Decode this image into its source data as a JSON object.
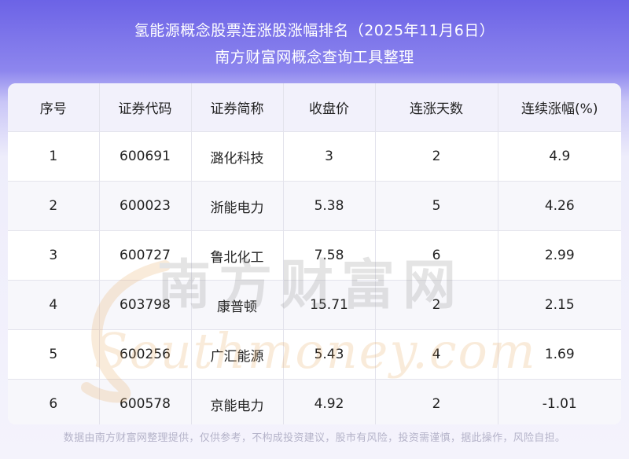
{
  "header": {
    "title": "氢能源概念股票连涨股涨幅排名（2025年11月6日）",
    "subtitle": "南方财富网概念查询工具整理"
  },
  "table": {
    "columns": [
      "序号",
      "证券代码",
      "证券简称",
      "收盘价",
      "连涨天数",
      "连续涨幅(%)"
    ],
    "rows": [
      [
        "1",
        "600691",
        "潞化科技",
        "3",
        "2",
        "4.9"
      ],
      [
        "2",
        "600023",
        "浙能电力",
        "5.38",
        "5",
        "4.26"
      ],
      [
        "3",
        "600727",
        "鲁北化工",
        "7.58",
        "6",
        "2.99"
      ],
      [
        "4",
        "603798",
        "康普顿",
        "15.71",
        "2",
        "2.15"
      ],
      [
        "5",
        "600256",
        "广汇能源",
        "5.43",
        "4",
        "1.69"
      ],
      [
        "6",
        "600578",
        "京能电力",
        "4.92",
        "2",
        "-1.01"
      ]
    ]
  },
  "watermark": {
    "cn": "南方财富网",
    "en": "Southmoney.com"
  },
  "footer": {
    "disclaimer": "数据由南方财富网整理提供，仅供参考，不构成投资建议，股市有风险，投资需谨慎，据此操作，风险自担。"
  },
  "colors": {
    "header_top": "#6c63e6",
    "header_bg_light": "#f2f1fb",
    "watermark": "#e8a75c"
  }
}
